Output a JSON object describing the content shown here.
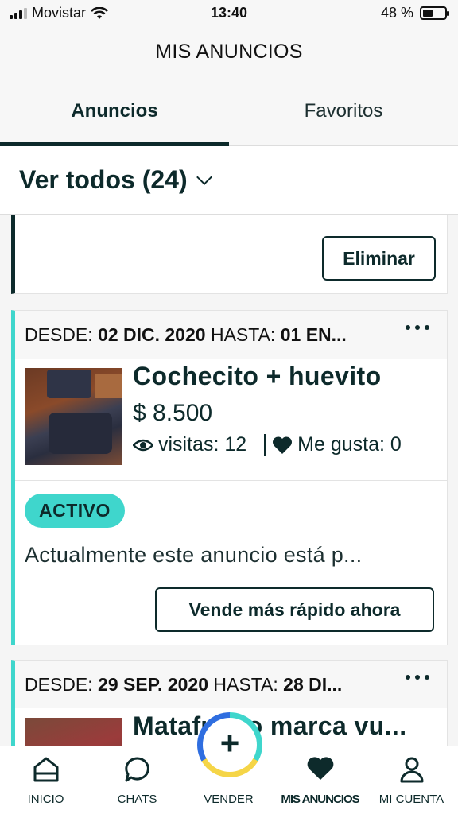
{
  "status_bar": {
    "carrier": "Movistar",
    "time": "13:40",
    "battery": "48 %",
    "battery_level": 0.48
  },
  "header": {
    "title": "MIS ANUNCIOS"
  },
  "tabs": [
    {
      "label": "Anuncios",
      "active": true
    },
    {
      "label": "Favoritos",
      "active": false
    }
  ],
  "filter": {
    "label": "Ver todos (24)"
  },
  "cards": [
    {
      "delete_button": "Eliminar"
    },
    {
      "date_from_label": "DESDE:",
      "date_from": "02 DIC. 2020",
      "date_to_label": "HASTA:",
      "date_to": "01 EN...",
      "title": "Cochecito + huevito",
      "price": "$ 8.500",
      "visits": "visitas: 12",
      "likes": "Me gusta: 0",
      "badge": "ACTIVO",
      "status_text": "Actualmente este anuncio está p...",
      "cta": "Vende más rápido ahora"
    },
    {
      "date_from_label": "DESDE:",
      "date_from": "29 SEP. 2020",
      "date_to_label": "HASTA:",
      "date_to": "28 DI...",
      "title": "Matafuego marca vu..."
    }
  ],
  "nav": [
    {
      "label": "INICIO",
      "icon": "home-icon"
    },
    {
      "label": "CHATS",
      "icon": "chat-icon"
    },
    {
      "label": "VENDER",
      "icon": "plus-icon"
    },
    {
      "label": "MIS ANUNCIOS",
      "icon": "heart-icon",
      "active": true
    },
    {
      "label": "MI CUENTA",
      "icon": "user-icon"
    }
  ],
  "colors": {
    "primary": "#0d2a2b",
    "accent": "#3fd6cc",
    "fab_yellow": "#f5d547",
    "fab_blue": "#2f6ee0"
  }
}
